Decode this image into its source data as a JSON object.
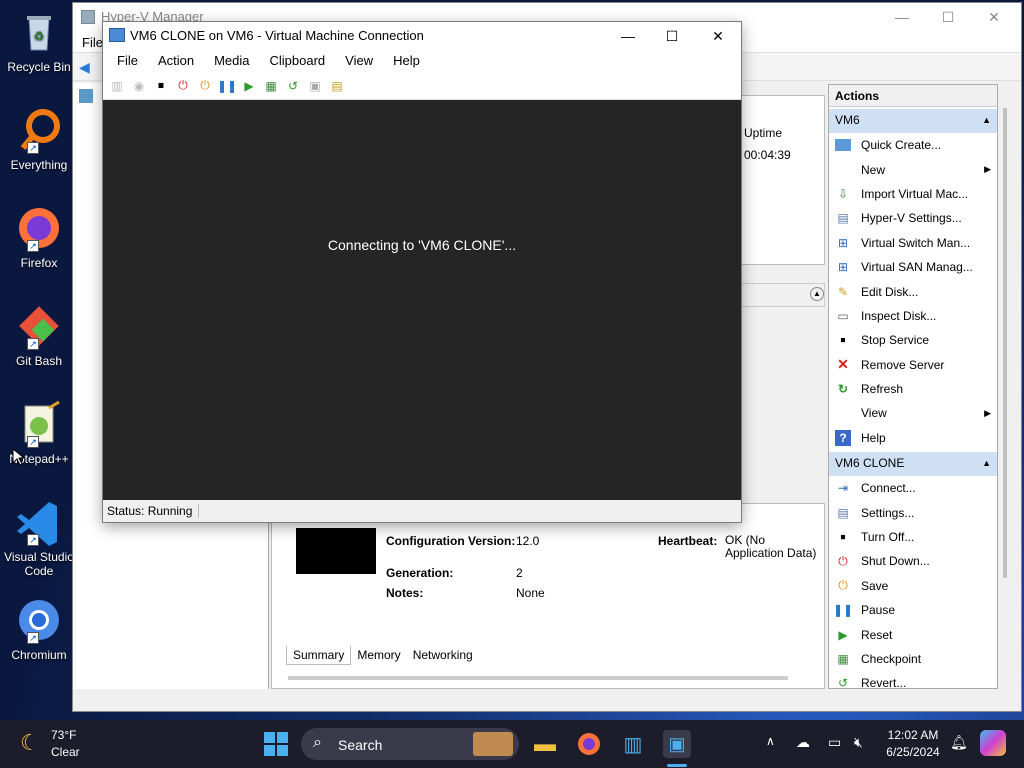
{
  "desktop": {
    "icons": [
      {
        "label": "Recycle Bin"
      },
      {
        "label": "Everything"
      },
      {
        "label": "Firefox"
      },
      {
        "label": "Git Bash"
      },
      {
        "label": "Notepad++"
      },
      {
        "label": "Visual Studio Code"
      },
      {
        "label": "Chromium"
      }
    ]
  },
  "hyperv": {
    "title": "Hyper-V Manager",
    "menu_file": "File",
    "vm_columns": {
      "uptime": "Uptime"
    },
    "vm_uptime": "00:04:39",
    "details": {
      "config_label": "Configuration Version:",
      "config_value": "12.0",
      "gen_label": "Generation:",
      "gen_value": "2",
      "notes_label": "Notes:",
      "notes_value": "None",
      "heartbeat_label": "Heartbeat:",
      "heartbeat_value": "OK (No Application Data)"
    },
    "tabs": [
      "Summary",
      "Memory",
      "Networking"
    ]
  },
  "vmconnect": {
    "title": "VM6 CLONE on VM6 - Virtual Machine Connection",
    "menu": [
      "File",
      "Action",
      "Media",
      "Clipboard",
      "View",
      "Help"
    ],
    "screen_message": "Connecting to 'VM6 CLONE'...",
    "status": "Status: Running"
  },
  "actions": {
    "header": "Actions",
    "section1": {
      "title": "VM6",
      "items": [
        "Quick Create...",
        "New",
        "Import Virtual Mac...",
        "Hyper-V Settings...",
        "Virtual Switch Man...",
        "Virtual SAN Manag...",
        "Edit Disk...",
        "Inspect Disk...",
        "Stop Service",
        "Remove Server",
        "Refresh",
        "View",
        "Help"
      ]
    },
    "section2": {
      "title": "VM6 CLONE",
      "items": [
        "Connect...",
        "Settings...",
        "Turn Off...",
        "Shut Down...",
        "Save",
        "Pause",
        "Reset",
        "Checkpoint",
        "Revert..."
      ]
    }
  },
  "taskbar": {
    "weather_temp": "73°F",
    "weather_cond": "Clear",
    "search": "Search",
    "time": "12:02 AM",
    "date": "6/25/2024"
  }
}
